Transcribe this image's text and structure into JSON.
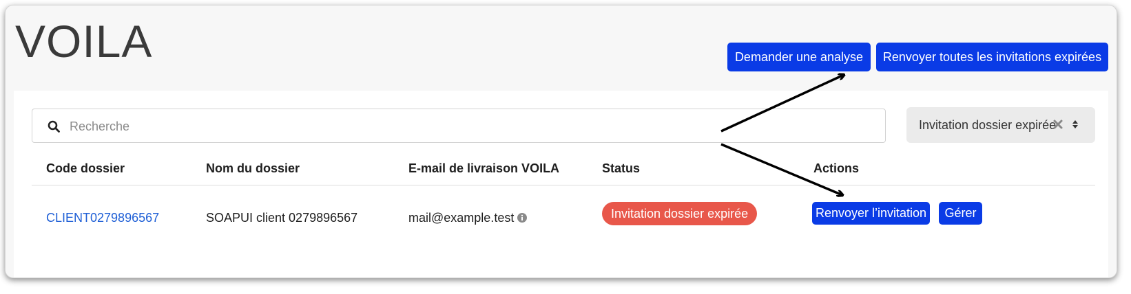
{
  "app": {
    "title": "VOILA"
  },
  "toolbar": {
    "request_analysis_label": "Demander une analyse",
    "resend_all_label": "Renvoyer toutes les invitations expirées"
  },
  "search": {
    "placeholder": "Recherche",
    "value": ""
  },
  "filter": {
    "selected": "Invitation dossier expirée"
  },
  "table": {
    "columns": [
      "Code dossier",
      "Nom du dossier",
      "E-mail de livraison VOILA",
      "Status",
      "Actions"
    ],
    "rows": [
      {
        "code": "CLIENT0279896567",
        "name": "SOAPUI client 0279896567",
        "email": "mail@example.test",
        "status": "Invitation dossier expirée",
        "actions": {
          "resend_label": "Renvoyer l’invitation",
          "manage_label": "Gérer"
        }
      }
    ]
  },
  "colors": {
    "primary_button": "#0a3be6",
    "status_expired": "#e8574a",
    "link": "#1f5fd6"
  },
  "icons": [
    "search-icon",
    "clear-icon",
    "sort-caret-icon",
    "info-icon",
    "arrow-icon"
  ]
}
